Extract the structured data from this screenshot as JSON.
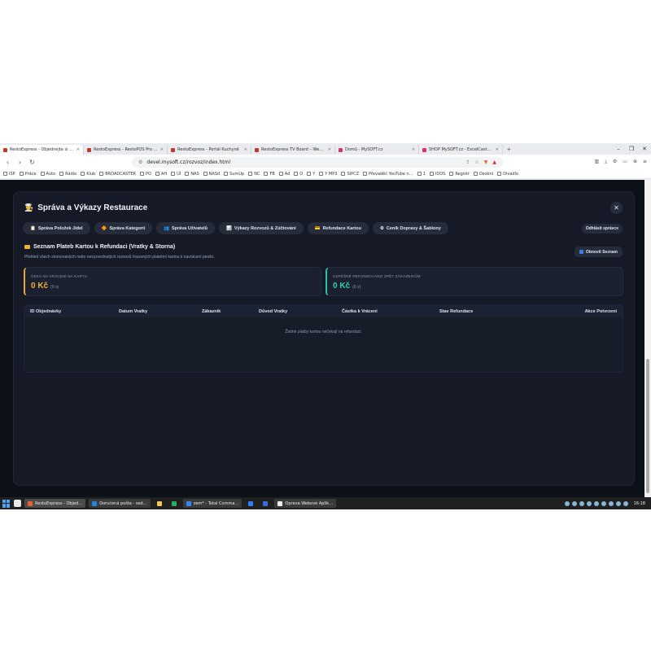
{
  "browser": {
    "tabs": [
      {
        "label": "RestoExpress - Objednejte si čer…",
        "active": true,
        "favicon_color": "#c0392b"
      },
      {
        "label": "RestoExpress - RestoPOS Pro V3.5",
        "active": false,
        "favicon_color": "#c0392b"
      },
      {
        "label": "RestoExpress - Portál Kuchyně",
        "active": false,
        "favicon_color": "#c0392b"
      },
      {
        "label": "RestoExpress TV Board – WebOS Hu…",
        "active": false,
        "favicon_color": "#c0392b"
      },
      {
        "label": "Domů - MySOFT.cz",
        "active": false,
        "favicon_color": "#d6336c"
      },
      {
        "label": "SHOP MySOFT.cz - ExcelCaster: scra…",
        "active": false,
        "favicon_color": "#d6336c"
      }
    ],
    "new_tab": "+",
    "url": "devel.mysoft.cz/rozvoz/index.html",
    "bookmarks": [
      "ISP",
      "Práce",
      "Auto",
      "Rádio",
      "Klub",
      "BROADCASTER",
      "PO",
      "AH",
      "ÚÍ",
      "NAS",
      "NASd",
      "SumUp",
      "NC",
      "FB",
      "Ad",
      "O",
      "Y",
      "Y MP3",
      "SIPCZ",
      "Převaděč YouTube n…",
      "1",
      "IDOS",
      "Registr",
      "Osobní",
      "Divadlo"
    ]
  },
  "modal": {
    "title": "Správa a Výkazy Restaurace",
    "title_icon": "chef-icon",
    "close_label": "✕",
    "tabs": [
      {
        "label": "Správa Položek Jídel",
        "icon": "📋"
      },
      {
        "label": "Správa Kategorií",
        "icon": "🔶"
      },
      {
        "label": "Správa Uživatelů",
        "icon": "👥"
      },
      {
        "label": "Výkazy Rozvozů & Zúčtování",
        "icon": "📊"
      },
      {
        "label": "Refundace Kartou",
        "icon": "💳"
      },
      {
        "label": "Ceník Dopravy & Šablony",
        "icon": "⚙"
      }
    ],
    "logout_label": "Odhlásit správce",
    "section": {
      "title": "Seznam Plateb Kartou k Refundaci (Vratky & Storna)",
      "subtitle": "Přehled všech stornovaných nebo nevyzvednutých rozvozů hrazených platební kartou k navrácení peněz.",
      "refresh_label": "Obnovit Seznam"
    },
    "stats": {
      "pending": {
        "label": "ČEKÁ NA VRÁCENÍ NA KARTU",
        "value": "0 Kč",
        "count": "(0 x)",
        "accent": "#e9a82b"
      },
      "done": {
        "label": "ÚSPĚŠNĚ REFUNDOVÁNO ZPĚT ZÁKAZNÍKŮM",
        "value": "0 Kč",
        "count": "(0 x)",
        "accent": "#25c49a"
      }
    },
    "table": {
      "columns": [
        "ID Objednávky",
        "Datum Vratky",
        "Zákazník",
        "Důvod Vratky",
        "Částka k Vrácení",
        "Stav Refundace",
        "Akce Potvrzení"
      ],
      "empty_message": "Žádné platby kartou nečekají na refundaci."
    }
  },
  "taskbar": {
    "apps": [
      {
        "label": "RestoExpress - Objed…",
        "color": "#e8622f",
        "active": true
      },
      {
        "label": "Doručená pošta - sed…",
        "color": "#1e88e5",
        "active": false
      },
      {
        "label": "",
        "color": "#f2c94c",
        "active": false
      },
      {
        "label": "",
        "color": "#27ae60",
        "active": false
      },
      {
        "label": "zem* - Total Comma…",
        "color": "#3b82f6",
        "active": false
      },
      {
        "label": "",
        "color": "#2d7ff9",
        "active": false
      },
      {
        "label": "",
        "color": "#3b6fd6",
        "active": false
      },
      {
        "label": "Oprava Webové Aplik…",
        "color": "#eeeeee",
        "active": false
      }
    ],
    "clock": "16:18"
  }
}
